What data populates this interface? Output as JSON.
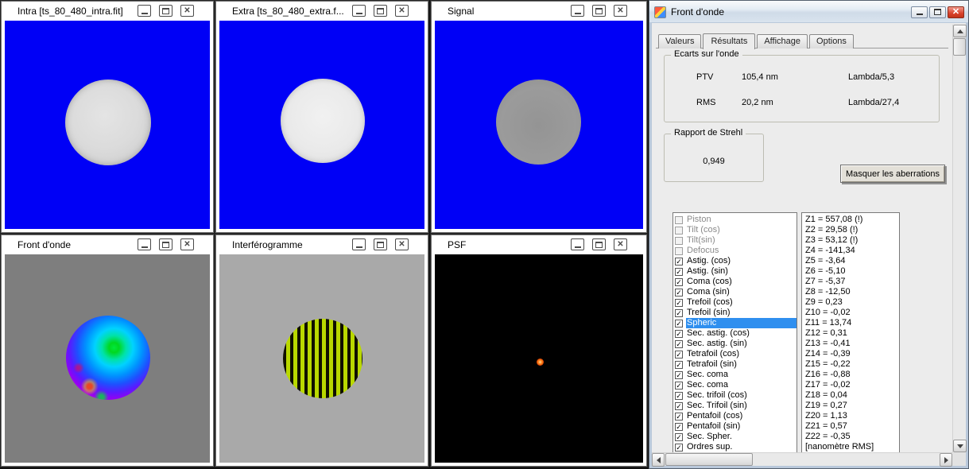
{
  "icons": {
    "check": "✓",
    "close": "✕"
  },
  "colors": {
    "selection": "#2F8FEF",
    "image_background": "#0000F6",
    "close_button": "#D9412B"
  },
  "windows": {
    "intra": {
      "title": "Intra [ts_80_480_intra.fit]"
    },
    "extra": {
      "title": "Extra [ts_80_480_extra.f..."
    },
    "signal": {
      "title": "Signal"
    },
    "front_onde": {
      "title": "Front d'onde"
    },
    "interferogramme": {
      "title": "Interférogramme"
    },
    "psf": {
      "title": "PSF"
    }
  },
  "panel": {
    "title": "Front d'onde",
    "tabs": [
      "Valeurs",
      "Résultats",
      "Affichage",
      "Options"
    ],
    "active_tab": "Résultats",
    "ecarts": {
      "group_label": "Ecarts sur l'onde",
      "rows": [
        {
          "label": "PTV",
          "value": "105,4 nm",
          "lambda": "Lambda/5,3"
        },
        {
          "label": "RMS",
          "value": "20,2 nm",
          "lambda": "Lambda/27,4"
        }
      ]
    },
    "strehl": {
      "group_label": "Rapport de Strehl",
      "value": "0,949"
    },
    "mask_button_label": "Masquer les aberrations",
    "aberrations": [
      {
        "label": "Piston",
        "checked": false,
        "disabled": true
      },
      {
        "label": "Tilt (cos)",
        "checked": false,
        "disabled": true
      },
      {
        "label": "Tilt(sin)",
        "checked": false,
        "disabled": true
      },
      {
        "label": "Defocus",
        "checked": false,
        "disabled": true
      },
      {
        "label": "Astig. (cos)",
        "checked": true
      },
      {
        "label": "Astig. (sin)",
        "checked": true
      },
      {
        "label": "Coma (cos)",
        "checked": true
      },
      {
        "label": "Coma (sin)",
        "checked": true
      },
      {
        "label": "Trefoil (cos)",
        "checked": true
      },
      {
        "label": "Trefoil (sin)",
        "checked": true
      },
      {
        "label": "Spheric",
        "checked": true,
        "selected": true
      },
      {
        "label": "Sec. astig. (cos)",
        "checked": true
      },
      {
        "label": "Sec. astig. (sin)",
        "checked": true
      },
      {
        "label": "Tetrafoil (cos)",
        "checked": true
      },
      {
        "label": "Tetrafoil (sin)",
        "checked": true
      },
      {
        "label": "Sec. coma",
        "checked": true
      },
      {
        "label": "Sec. coma",
        "checked": true
      },
      {
        "label": "Sec. trifoil (cos)",
        "checked": true
      },
      {
        "label": "Sec. Trifoil (sin)",
        "checked": true
      },
      {
        "label": "Pentafoil (cos)",
        "checked": true
      },
      {
        "label": "Pentafoil (sin)",
        "checked": true
      },
      {
        "label": "Sec. Spher.",
        "checked": true
      },
      {
        "label": "Ordres sup.",
        "checked": true
      }
    ],
    "zernike": [
      "Z1 = 557,08  (!)",
      "Z2 = 29,58  (!)",
      "Z3 = 53,12  (!)",
      "Z4 = -141,34",
      "Z5 = -3,64",
      "Z6 = -5,10",
      "Z7 = -5,37",
      "Z8 = -12,50",
      "Z9 = 0,23",
      "Z10 = -0,02",
      "Z11 = 13,74",
      "Z12 = 0,31",
      "Z13 = -0,41",
      "Z14 = -0,39",
      "Z15 = -0,22",
      "Z16 = -0,88",
      "Z17 = -0,02",
      "Z18 = 0,04",
      "Z19 = 0,27",
      "Z20 = 1,13",
      "Z21 = 0,57",
      "Z22 = -0,35",
      "[nanomètre RMS]"
    ]
  }
}
